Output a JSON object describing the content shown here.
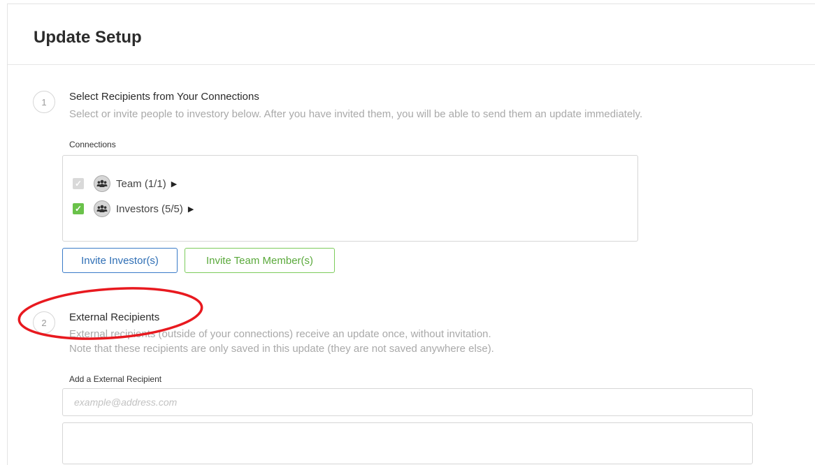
{
  "header": {
    "title": "Update Setup"
  },
  "step1": {
    "number": "1",
    "title": "Select Recipients from Your Connections",
    "description": "Select or invite people to investory below. After you have invited them, you will be able to send them an update immediately.",
    "connections_label": "Connections",
    "groups": [
      {
        "label": "Team (1/1)",
        "checked": true,
        "disabled": true
      },
      {
        "label": "Investors (5/5)",
        "checked": true,
        "disabled": false
      }
    ],
    "invite_investor_label": "Invite Investor(s)",
    "invite_team_label": "Invite Team Member(s)"
  },
  "step2": {
    "number": "2",
    "title": "External Recipients",
    "description_line1": "External recipients (outside of your connections) receive an update once, without invitation.",
    "description_line2": "Note that these recipients are only saved in this update (they are not saved anywhere else).",
    "add_label": "Add a External Recipient",
    "email_placeholder": "example@address.com"
  },
  "colors": {
    "primary_blue": "#3a7bc8",
    "success_green": "#6ac24a",
    "annotation_red": "#e8191f"
  },
  "icons": {
    "group": "users-icon",
    "check": "check-icon",
    "caret": "caret-right-icon"
  }
}
